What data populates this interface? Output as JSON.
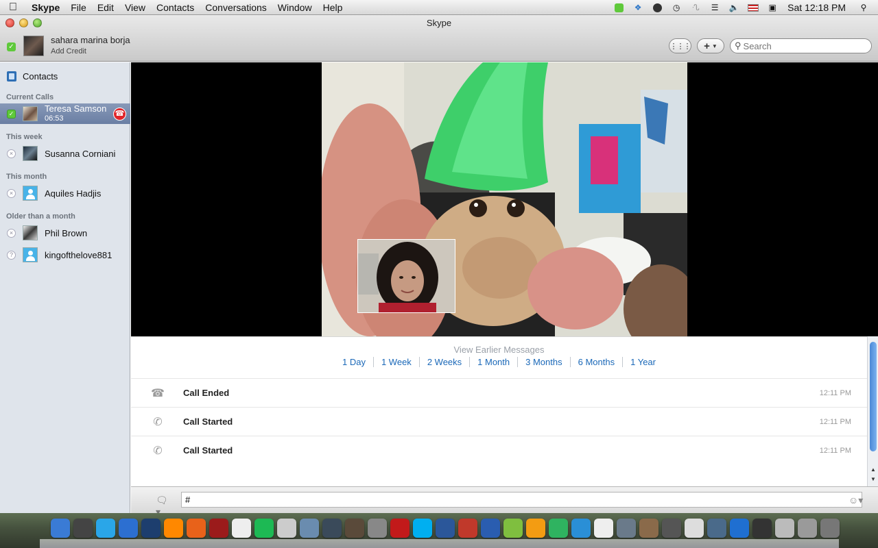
{
  "menubar": {
    "apple_icon": "apple-icon",
    "app_name": "Skype",
    "items": [
      "File",
      "Edit",
      "View",
      "Contacts",
      "Conversations",
      "Window",
      "Help"
    ],
    "clock": "Sat 12:18 PM"
  },
  "window": {
    "title": "Skype"
  },
  "account": {
    "name": "sahara marina borja",
    "credit_label": "Add Credit",
    "status": "online"
  },
  "toolbar": {
    "dialpad_icon": "dialpad-icon",
    "add_label": "+",
    "search_placeholder": "Search"
  },
  "sidebar": {
    "contacts_label": "Contacts",
    "sections": {
      "current_calls": "Current Calls",
      "this_week": "This week",
      "this_month": "This month",
      "older": "Older than a month"
    },
    "current_call": {
      "name": "Teresa Samson",
      "duration": "06:53"
    },
    "contacts": [
      {
        "name": "Susanna Corniani"
      },
      {
        "name": "Aquiles Hadjis"
      },
      {
        "name": "Phil Brown"
      },
      {
        "name": "kingofthelove881"
      }
    ]
  },
  "chat": {
    "earlier_label": "View Earlier Messages",
    "ranges": [
      "1 Day",
      "1 Week",
      "2 Weeks",
      "1 Month",
      "3 Months",
      "6 Months",
      "1 Year"
    ],
    "events": [
      {
        "text": "Call Ended",
        "time": "12:11 PM",
        "icon": "call-ended-icon"
      },
      {
        "text": "Call Started",
        "time": "12:11 PM",
        "icon": "call-incoming-icon"
      },
      {
        "text": "Call Started",
        "time": "12:11 PM",
        "icon": "call-outgoing-icon"
      }
    ]
  },
  "compose": {
    "value": "#"
  },
  "dock": {
    "apps": [
      "Finder",
      "Dashboard",
      "iChat",
      "Safari",
      "Photoshop",
      "VLC",
      "Firefox",
      "Photo Booth",
      "iCal",
      "Spotify",
      "Preview",
      "iPhoto",
      "Lightroom",
      "Aperture",
      "Preferences",
      "Flash",
      "Skype",
      "Word",
      "Books",
      "Vise",
      "Ninja",
      "Pages",
      "Chrome",
      "Messenger",
      "Directory",
      "Grab",
      "Automator",
      "Image Capture",
      "Network",
      "Screen Sharing",
      "iTunes",
      "Camera",
      "Utility",
      "Documents",
      "Trash"
    ]
  }
}
